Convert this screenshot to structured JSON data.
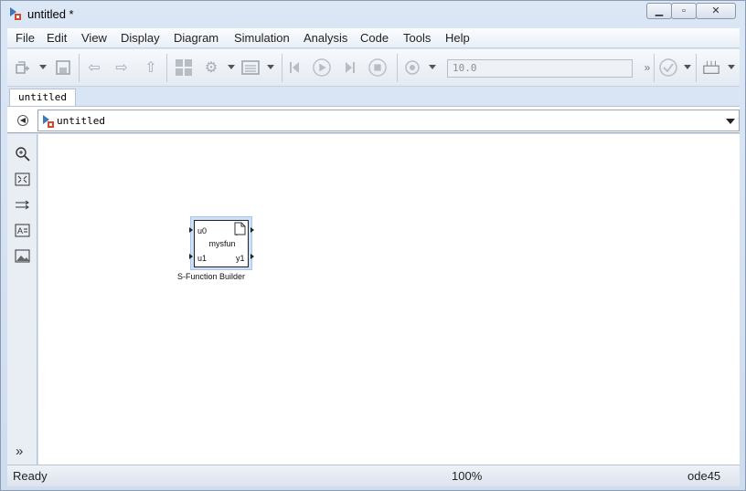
{
  "window": {
    "title": "untitled *"
  },
  "menu": [
    "File",
    "Edit",
    "View",
    "Display",
    "Diagram",
    "Simulation",
    "Analysis",
    "Code",
    "Tools",
    "Help"
  ],
  "toolbar": {
    "stop_time": "10.0",
    "icons": [
      "new-model-icon",
      "save-icon",
      "back-icon",
      "forward-icon",
      "up-icon",
      "library-browser-icon",
      "model-config-icon",
      "model-explorer-icon",
      "step-back-icon",
      "run-icon",
      "step-forward-icon",
      "stop-icon",
      "record-icon",
      "more-icon",
      "check-icon",
      "build-icon"
    ]
  },
  "tab": {
    "label": "untitled"
  },
  "explorer": {
    "path": "untitled"
  },
  "palette": [
    "zoom-icon",
    "fit-view-icon",
    "route-lines-icon",
    "annotation-icon",
    "image-icon"
  ],
  "block": {
    "name": "mysfun",
    "caption": "S-Function Builder",
    "inports": [
      "u0",
      "u1"
    ],
    "outports": [
      "y0",
      "y1"
    ]
  },
  "status": {
    "left": "Ready",
    "zoom": "100%",
    "solver": "ode45"
  },
  "colors": {
    "window_bg": "#dbe7f5",
    "canvas_bg": "#ffffff",
    "selection": "#cde0f7"
  }
}
